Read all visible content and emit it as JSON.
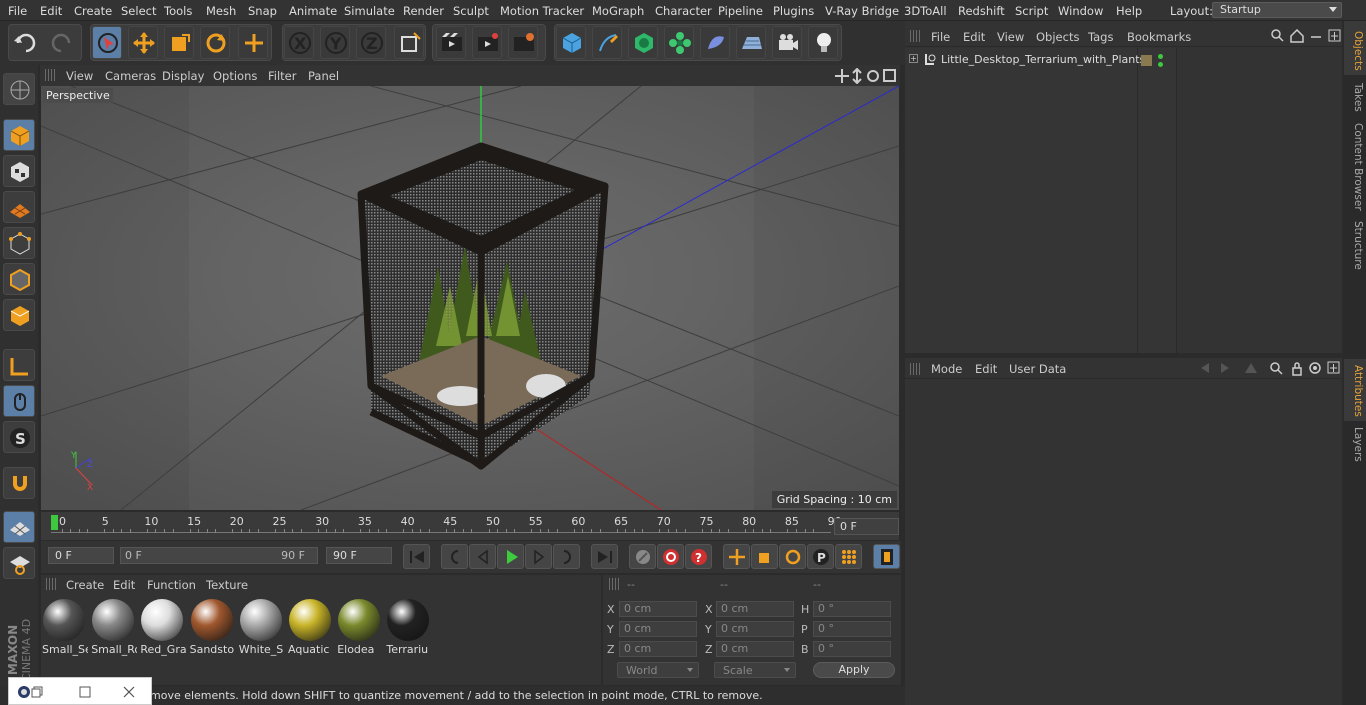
{
  "menubar": {
    "items": [
      "File",
      "Edit",
      "Create",
      "Select",
      "Tools",
      "Mesh",
      "Snap",
      "Animate",
      "Simulate",
      "Render",
      "Sculpt",
      "Motion Tracker",
      "MoGraph",
      "Character",
      "Pipeline",
      "Plugins",
      "V-Ray Bridge",
      "3DToAll",
      "Redshift",
      "Script",
      "Window",
      "Help"
    ],
    "layout_label": "Layout:",
    "layout_value": "Startup"
  },
  "viewport": {
    "menu": [
      "View",
      "Cameras",
      "Display",
      "Options",
      "Filter",
      "Panel"
    ],
    "label": "Perspective",
    "grid_spacing": "Grid Spacing : 10 cm",
    "axis_x": "X",
    "axis_y": "Y",
    "axis_z": "Z"
  },
  "timeline": {
    "ticks": [
      "0",
      "5",
      "10",
      "15",
      "20",
      "25",
      "30",
      "35",
      "40",
      "45",
      "50",
      "55",
      "60",
      "65",
      "70",
      "75",
      "80",
      "85",
      "90"
    ],
    "current_frame": "0 F"
  },
  "transport": {
    "start_field": "0 F",
    "range_start": "0 F",
    "range_end": "90 F",
    "end_field": "90 F"
  },
  "materials": {
    "menu": [
      "Create",
      "Edit",
      "Function",
      "Texture"
    ],
    "items": [
      {
        "label": "Small_Se",
        "color": "#555"
      },
      {
        "label": "Small_Ro",
        "color": "#888"
      },
      {
        "label": "Red_Gra",
        "color": "#ddd"
      },
      {
        "label": "Sandsto",
        "color": "#a0582e"
      },
      {
        "label": "White_S",
        "color": "#aaa"
      },
      {
        "label": "Aquatic",
        "color": "#c8b428"
      },
      {
        "label": "Elodea",
        "color": "#7a8a2c"
      },
      {
        "label": "Terrariu",
        "color": "#222"
      }
    ]
  },
  "coords": {
    "header": [
      "--",
      "--",
      "--"
    ],
    "rows": [
      {
        "l1": "X",
        "v1": "0 cm",
        "l2": "X",
        "v2": "0 cm",
        "l3": "H",
        "v3": "0 °"
      },
      {
        "l1": "Y",
        "v1": "0 cm",
        "l2": "Y",
        "v2": "0 cm",
        "l3": "P",
        "v3": "0 °"
      },
      {
        "l1": "Z",
        "v1": "0 cm",
        "l2": "Z",
        "v2": "0 cm",
        "l3": "B",
        "v3": "0 °"
      }
    ],
    "world": "World",
    "scale": "Scale",
    "apply": "Apply"
  },
  "status": {
    "text": "move elements. Hold down SHIFT to quantize movement / add to the selection in point mode, CTRL to remove."
  },
  "objects": {
    "menu": [
      "File",
      "Edit",
      "View",
      "Objects",
      "Tags",
      "Bookmarks"
    ],
    "items": [
      {
        "name": "Little_Desktop_Terrarium_with_Plants"
      }
    ]
  },
  "attributes": {
    "menu": [
      "Mode",
      "Edit",
      "User Data"
    ]
  },
  "right_tabs": {
    "objects": "Objects",
    "takes": "Takes",
    "content_browser": "Content Browser",
    "structure": "Structure",
    "attributes": "Attributes",
    "layers": "Layers"
  },
  "brand": {
    "maxon": "MAXON",
    "cinema": "CINEMA 4D"
  },
  "colors": {
    "accent": "#5b7fa6",
    "active_tab": "#e8a33a",
    "play_green": "#3ecb3e"
  }
}
